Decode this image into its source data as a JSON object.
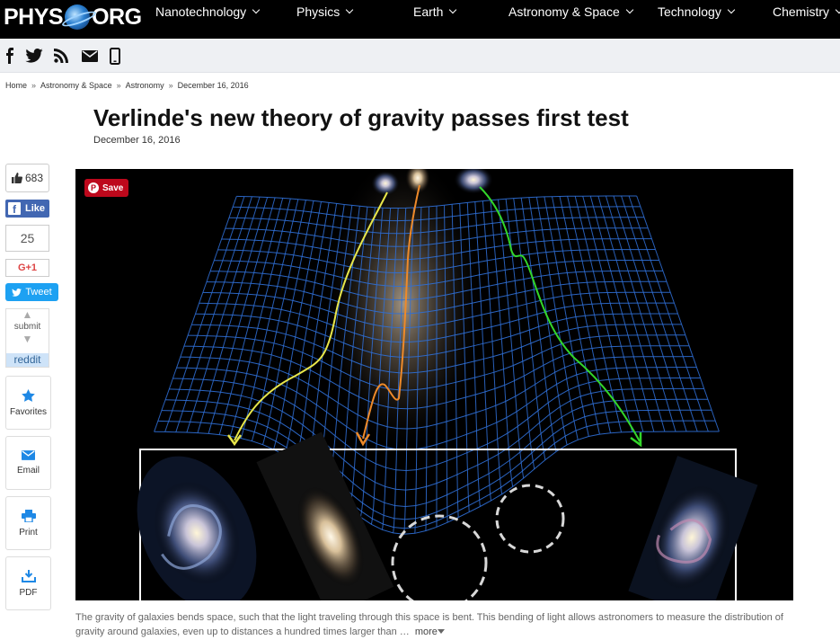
{
  "brand": {
    "left": "PHYS",
    "right": "ORG"
  },
  "nav": [
    {
      "label": "Nanotechnology"
    },
    {
      "label": "Physics"
    },
    {
      "label": "Earth"
    },
    {
      "label": "Astronomy & Space"
    },
    {
      "label": "Technology"
    },
    {
      "label": "Chemistry"
    }
  ],
  "social_icons": [
    "facebook-icon",
    "twitter-icon",
    "rss-icon",
    "email-icon",
    "mobile-icon"
  ],
  "breadcrumb": [
    "Home",
    "Astronomy & Space",
    "Astronomy",
    "December 16, 2016"
  ],
  "article": {
    "title": "Verlinde's new theory of gravity passes first test",
    "date": "December 16, 2016"
  },
  "share": {
    "like_count": "683",
    "fb_like": "Like",
    "gplus_count": "25",
    "gplus": "G+1",
    "tweet": "Tweet",
    "reddit_submit": "submit",
    "reddit": "reddit",
    "favorites": "Favorites",
    "email": "Email",
    "print": "Print",
    "pdf": "PDF"
  },
  "pinterest": {
    "save": "Save"
  },
  "caption": {
    "text": "The gravity of galaxies bends space, such that the light traveling through this space is bent. This bending of light allows astronomers to measure the distribution of gravity around galaxies, even up to distances a hundred times larger than …",
    "more": "more"
  },
  "colors": {
    "grid": "#2f6fd6",
    "yellow_ray": "#e8e64a",
    "orange_ray": "#ee8a2a",
    "green_ray": "#33d62a",
    "pinterest": "#bd081c",
    "facebook": "#4267b2",
    "twitter": "#1da1f2"
  }
}
